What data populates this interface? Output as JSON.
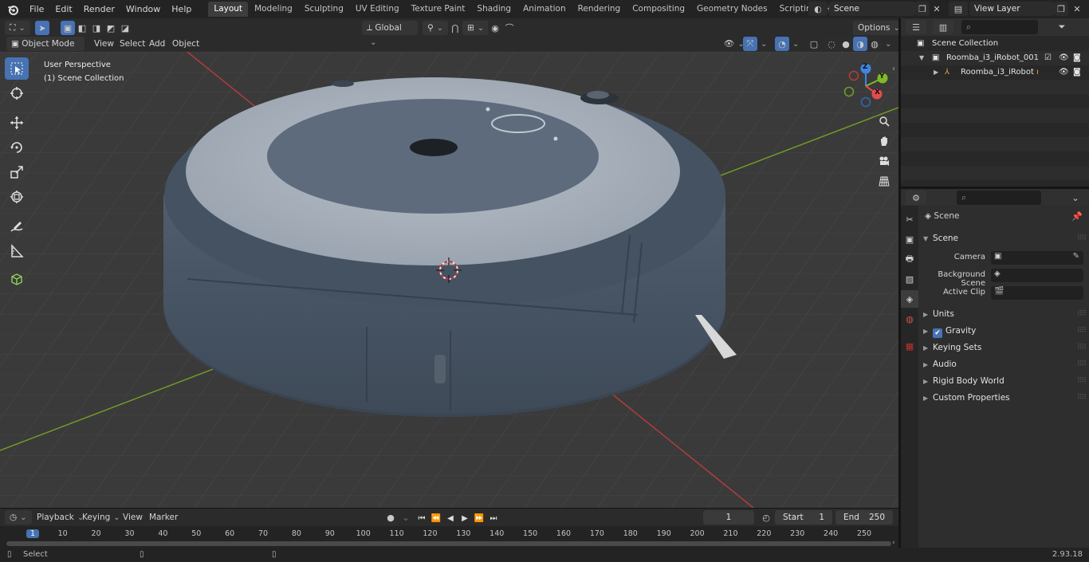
{
  "menubar": {
    "items": [
      "File",
      "Edit",
      "Render",
      "Window",
      "Help"
    ],
    "workspaces": [
      "Layout",
      "Modeling",
      "Sculpting",
      "UV Editing",
      "Texture Paint",
      "Shading",
      "Animation",
      "Rendering",
      "Compositing",
      "Geometry Nodes",
      "Scripting"
    ],
    "active_workspace": "Layout",
    "scene_name": "Scene",
    "view_layer_name": "View Layer"
  },
  "viewport_header": {
    "mode": "Object Mode",
    "menus": [
      "View",
      "Select",
      "Add",
      "Object"
    ],
    "transform_orientation": "Global",
    "options_label": "Options"
  },
  "viewport": {
    "perspective_label": "User Perspective",
    "collection_label": "(1) Scene Collection"
  },
  "gizmo": {
    "x_label": "X",
    "y_label": "Y",
    "z_label": "Z"
  },
  "outliner": {
    "root": "Scene Collection",
    "collection": "Roomba_i3_iRobot_001",
    "object": "Roomba_i3_iRobot"
  },
  "properties": {
    "context_name": "Scene",
    "section": "Scene",
    "camera_label": "Camera",
    "background_scene_label": "Background Scene",
    "active_clip_label": "Active Clip",
    "panels": [
      "Units",
      "Gravity",
      "Keying Sets",
      "Audio",
      "Rigid Body World",
      "Custom Properties"
    ]
  },
  "timeline": {
    "menus": [
      "Playback",
      "Keying",
      "View",
      "Marker"
    ],
    "current_frame": "1",
    "start_label": "Start",
    "start_value": "1",
    "end_label": "End",
    "end_value": "250",
    "ruler_ticks": [
      "1",
      "10",
      "20",
      "30",
      "40",
      "50",
      "60",
      "70",
      "80",
      "90",
      "100",
      "110",
      "120",
      "130",
      "140",
      "150",
      "160",
      "170",
      "180",
      "190",
      "200",
      "210",
      "220",
      "230",
      "240",
      "250"
    ]
  },
  "statusbar": {
    "left": "Select",
    "version": "2.93.18"
  },
  "colors": {
    "accent": "#4772b3",
    "axis_x": "#e44b4b",
    "axis_y": "#7fba26",
    "axis_z": "#3f85e2",
    "viewport_bg": "#3a3a3a"
  }
}
